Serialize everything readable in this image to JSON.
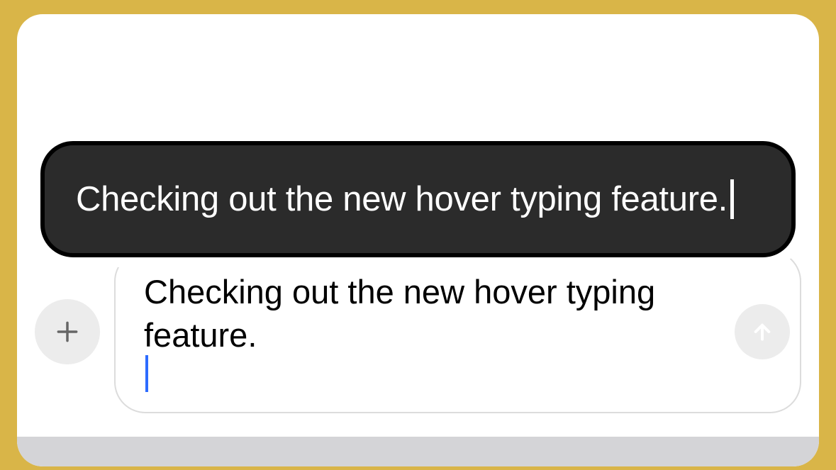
{
  "hover": {
    "text": "Checking out the new hover typing feature."
  },
  "input": {
    "text": "Checking out the new hover typing feature."
  },
  "icons": {
    "plus": "plus",
    "send": "arrow-up"
  },
  "colors": {
    "background": "#d9b548",
    "card": "#ffffff",
    "hoverBg": "#2b2b2b",
    "cursor": "#2d6cff"
  }
}
